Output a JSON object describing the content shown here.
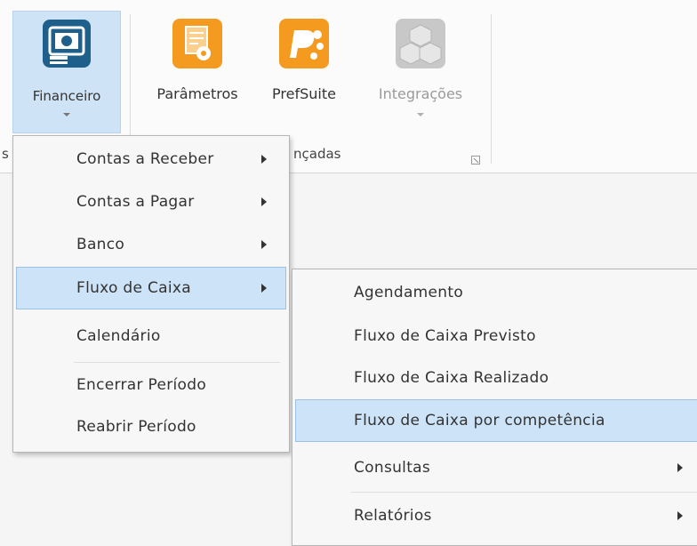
{
  "ribbon": {
    "buttons": [
      {
        "label": "Financeiro",
        "selected": true,
        "has_dropdown": true,
        "icon": "financeiro-icon"
      },
      {
        "label": "Parâmetros",
        "selected": false,
        "has_dropdown": false,
        "icon": "parametros-icon"
      },
      {
        "label": "PrefSuite",
        "selected": false,
        "has_dropdown": false,
        "icon": "prefsuite-icon"
      },
      {
        "label": "Integrações",
        "disabled": true,
        "has_dropdown": true,
        "icon": "integracoes-icon"
      }
    ],
    "group_label_left": "s",
    "group_label_right": "nçadas"
  },
  "financeiro_menu": {
    "items": [
      {
        "label": "Contas a Receber",
        "submenu": true
      },
      {
        "label": "Contas a Pagar",
        "submenu": true
      },
      {
        "label": "Banco",
        "submenu": true
      },
      {
        "label": "Fluxo de Caixa",
        "submenu": true,
        "highlighted": true
      },
      {
        "label": "Calendário",
        "submenu": false
      },
      {
        "label": "Encerrar Período",
        "submenu": false
      },
      {
        "label": "Reabrir Período",
        "submenu": false
      }
    ]
  },
  "fluxo_submenu": {
    "items": [
      {
        "label": "Agendamento",
        "submenu": false
      },
      {
        "label": "Fluxo de Caixa Previsto",
        "submenu": false
      },
      {
        "label": "Fluxo de Caixa Realizado",
        "submenu": false
      },
      {
        "label": "Fluxo de Caixa por competência",
        "submenu": false,
        "highlighted": true
      },
      {
        "label": "Consultas",
        "submenu": true
      },
      {
        "label": "Relatórios",
        "submenu": true
      }
    ]
  },
  "colors": {
    "highlight": "#cde3f7",
    "financeiro_icon": "#1f5f8b",
    "orange_icon": "#f39a1f",
    "disabled_icon": "#c8c8c8"
  }
}
